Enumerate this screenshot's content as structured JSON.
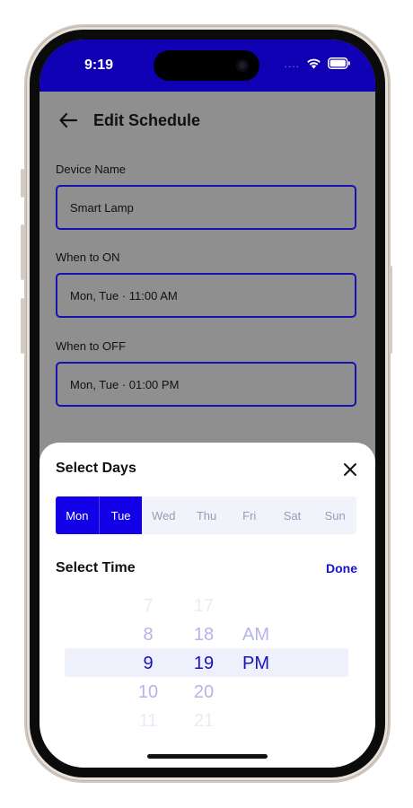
{
  "status_bar": {
    "time": "9:19",
    "signal_text": "....",
    "color": "#1000b3"
  },
  "page": {
    "title": "Edit Schedule",
    "back_icon": "arrow-left-icon",
    "fields": [
      {
        "label": "Device Name",
        "value": "Smart Lamp"
      },
      {
        "label": "When to ON",
        "value": "Mon, Tue · 11:00 AM"
      },
      {
        "label": "When to OFF",
        "value": "Mon, Tue · 01:00 PM"
      }
    ]
  },
  "sheet": {
    "days_title": "Select Days",
    "close_icon": "close-icon",
    "days": [
      {
        "label": "Mon",
        "selected": true
      },
      {
        "label": "Tue",
        "selected": true
      },
      {
        "label": "Wed",
        "selected": false
      },
      {
        "label": "Thu",
        "selected": false
      },
      {
        "label": "Fri",
        "selected": false
      },
      {
        "label": "Sat",
        "selected": false
      },
      {
        "label": "Sun",
        "selected": false
      }
    ],
    "time_title": "Select Time",
    "done_label": "Done",
    "picker": {
      "hours": [
        "7",
        "8",
        "9",
        "10",
        "11"
      ],
      "minutes": [
        "17",
        "18",
        "19",
        "20",
        "21"
      ],
      "ampm": [
        "",
        "AM",
        "PM",
        "",
        ""
      ],
      "selected": {
        "hour": "9",
        "minute": "19",
        "ampm": "PM"
      }
    }
  },
  "colors": {
    "accent": "#1200e6",
    "field_border": "#1a10b0",
    "overlay": "#8f8f8f"
  }
}
